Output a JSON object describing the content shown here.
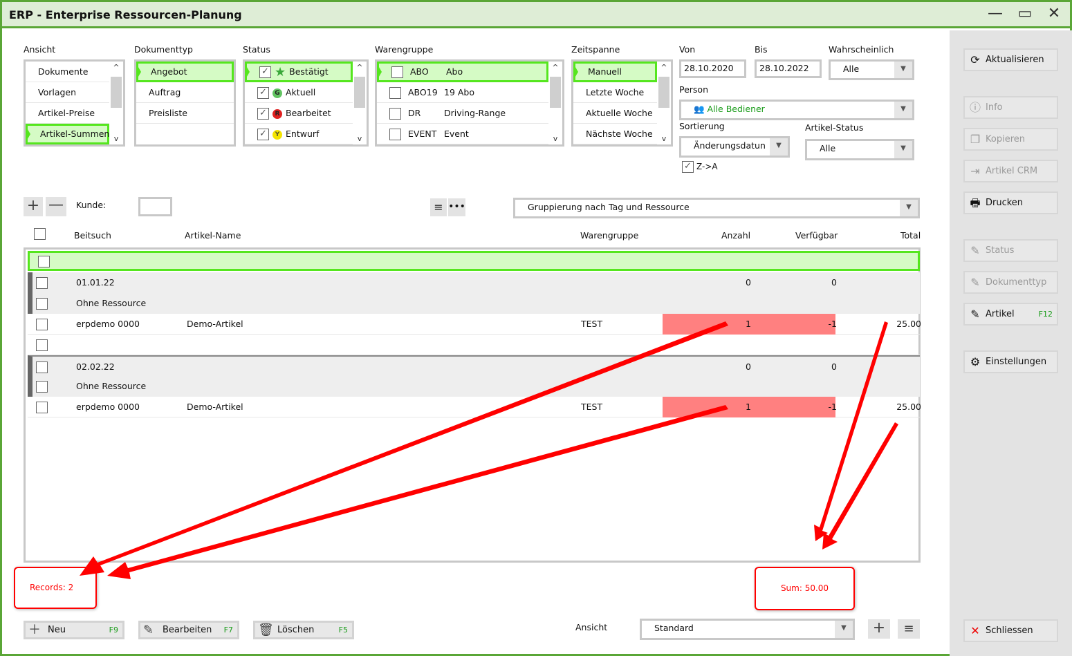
{
  "window": {
    "title": "ERP - Enterprise Ressourcen-Planung",
    "min": "—",
    "max": "▭",
    "close": "✕"
  },
  "filters": {
    "ansicht": {
      "label": "Ansicht",
      "items": [
        "Dokumente",
        "Vorlagen",
        "Artikel-Preise",
        "Artikel-Summen"
      ],
      "selected": 3
    },
    "dokumenttyp": {
      "label": "Dokumenttyp",
      "items": [
        "Angebot",
        "Auftrag",
        "Preisliste"
      ],
      "selected": 0
    },
    "status": {
      "label": "Status",
      "items": [
        {
          "label": "Bestätigt",
          "badge": "★",
          "color": "#3aa83a"
        },
        {
          "label": "Aktuell",
          "badge": "G",
          "color": "#62c462"
        },
        {
          "label": "Bearbeitet",
          "badge": "R",
          "color": "#e02020"
        },
        {
          "label": "Entwurf",
          "badge": "Y",
          "color": "#f4e400"
        }
      ],
      "selected": 0
    },
    "warengruppe": {
      "label": "Warengruppe",
      "items": [
        {
          "code": "ABO",
          "name": "Abo"
        },
        {
          "code": "ABO19",
          "name": "19 Abo"
        },
        {
          "code": "DR",
          "name": "Driving-Range"
        },
        {
          "code": "EVENT",
          "name": "Event"
        }
      ],
      "selected": 0
    },
    "zeitspanne": {
      "label": "Zeitspanne",
      "items": [
        "Manuell",
        "Letzte Woche",
        "Aktuelle Woche",
        "Nächste Woche"
      ],
      "selected": 0
    },
    "von": {
      "label": "Von",
      "value": "28.10.2020"
    },
    "bis": {
      "label": "Bis",
      "value": "28.10.2022"
    },
    "wahrscheinlich": {
      "label": "Wahrscheinlich",
      "value": "Alle"
    },
    "person": {
      "label": "Person",
      "value": "Alle Bediener"
    },
    "sortierung": {
      "label": "Sortierung",
      "value": "Änderungsdatun"
    },
    "artikel_status": {
      "label": "Artikel-Status",
      "value": "Alle"
    },
    "za": {
      "label": "Z->A",
      "checked": true
    }
  },
  "toolbar": {
    "kunde_label": "Kunde:",
    "kunde_value": "",
    "grouping": "Gruppierung nach Tag und Ressource"
  },
  "table": {
    "headers": [
      "Beitsuch",
      "Artikel-Name",
      "Warengruppe",
      "Anzahl",
      "Verfügbar",
      "Total"
    ],
    "rows": [
      {
        "type": "group",
        "c1": "01.01.22",
        "anzahl": "0",
        "verf": "0"
      },
      {
        "type": "sub",
        "c1": "Ohne Ressource"
      },
      {
        "type": "item",
        "c1": "erpdemo 0000",
        "name": "Demo-Artikel",
        "wg": "TEST",
        "anzahl": "1",
        "verf": "-1",
        "total": "25.00"
      },
      {
        "type": "empty"
      },
      {
        "type": "group",
        "c1": "02.02.22",
        "anzahl": "0",
        "verf": "0"
      },
      {
        "type": "sub",
        "c1": "Ohne Ressource"
      },
      {
        "type": "item",
        "c1": "erpdemo 0000",
        "name": "Demo-Artikel",
        "wg": "TEST",
        "anzahl": "1",
        "verf": "-1",
        "total": "25.00"
      }
    ]
  },
  "annotations": {
    "records": "Records: 2",
    "sum": "Sum: 50.00"
  },
  "bottom": {
    "neu": "Neu",
    "neu_key": "F9",
    "bearbeiten": "Bearbeiten",
    "bearbeiten_key": "F7",
    "loeschen": "Löschen",
    "loeschen_key": "F5",
    "ansicht_label": "Ansicht",
    "ansicht_value": "Standard"
  },
  "side": [
    {
      "label": "Aktualisieren",
      "icon": "⟳",
      "dis": false
    },
    {
      "label": "Info",
      "icon": "ⓘ",
      "dis": true
    },
    {
      "label": "Kopieren",
      "icon": "❐",
      "dis": true
    },
    {
      "label": "Artikel CRM",
      "icon": "⇥",
      "dis": true
    },
    {
      "label": "Drucken",
      "icon": "🖶",
      "dis": false
    },
    {
      "label": "Status",
      "icon": "✎",
      "dis": true
    },
    {
      "label": "Dokumenttyp",
      "icon": "✎",
      "dis": true
    },
    {
      "label": "Artikel",
      "icon": "✎",
      "dis": false,
      "key": "F12"
    },
    {
      "label": "Einstellungen",
      "icon": "⚙",
      "dis": false
    },
    {
      "label": "Schliessen",
      "icon": "✕",
      "dis": false
    }
  ]
}
